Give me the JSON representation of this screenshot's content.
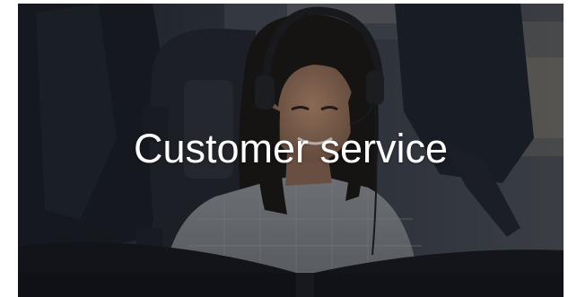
{
  "tile": {
    "caption": "Customer service",
    "caption_color": "#ffffff",
    "image_subject": "agent-with-headset-photo"
  }
}
